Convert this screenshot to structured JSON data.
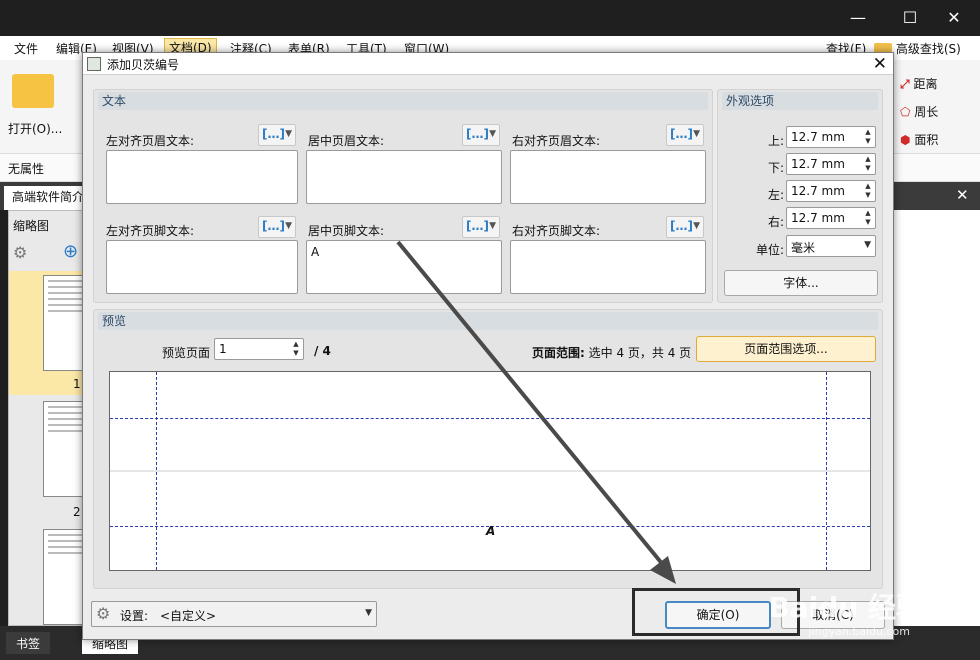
{
  "app": {
    "menu": [
      "文件",
      "编辑(E)",
      "视图(V)",
      "文档(D)",
      "注释(C)",
      "表单(R)",
      "工具(T)",
      "窗口(W)"
    ],
    "ribbon_open": "打开(O)...",
    "ribbon_right": [
      "距离",
      "周长",
      "面积"
    ],
    "search_label": "查找(F)",
    "advanced_search": "高级查找(S)",
    "properties_label": "无属性",
    "doc_tab": "高端软件简介",
    "thumbnails_panel": "缩略图",
    "thumb_page_1": "1",
    "thumb_page_2": "2",
    "bottom_tab_bookmarks": "书签",
    "bottom_tab_thumbnails": "缩略图"
  },
  "dialog": {
    "title": "添加贝茨编号",
    "text_group": "文本",
    "appearance_group": "外观选项",
    "left_header": "左对齐页眉文本:",
    "center_header": "居中页眉文本:",
    "right_header": "右对齐页眉文本:",
    "left_footer": "左对齐页脚文本:",
    "center_footer": "居中页脚文本:",
    "right_footer": "右对齐页脚文本:",
    "center_footer_value": "A",
    "macro_icon": "[…]",
    "margins": [
      {
        "label": "上:",
        "value": "12.7 mm"
      },
      {
        "label": "下:",
        "value": "12.7 mm"
      },
      {
        "label": "左:",
        "value": "12.7 mm"
      },
      {
        "label": "右:",
        "value": "12.7 mm"
      }
    ],
    "unit_label": "单位:",
    "unit_value": "毫米",
    "font_button": "字体...",
    "preview_group": "预览",
    "preview_page_label": "预览页面",
    "preview_page_value": "1",
    "preview_total": "/ 4",
    "page_range_label": "页面范围:",
    "page_range_value": "选中 4 页，共 4 页",
    "page_range_button": "页面范围选项...",
    "preview_text": "A",
    "settings_label": "设置:",
    "settings_value": "<自定义>",
    "ok_button": "确定(O)",
    "cancel_button": "取消(C)"
  },
  "watermark": {
    "brand": "Baidu 经验",
    "url": "jingyan.baidu.com"
  }
}
